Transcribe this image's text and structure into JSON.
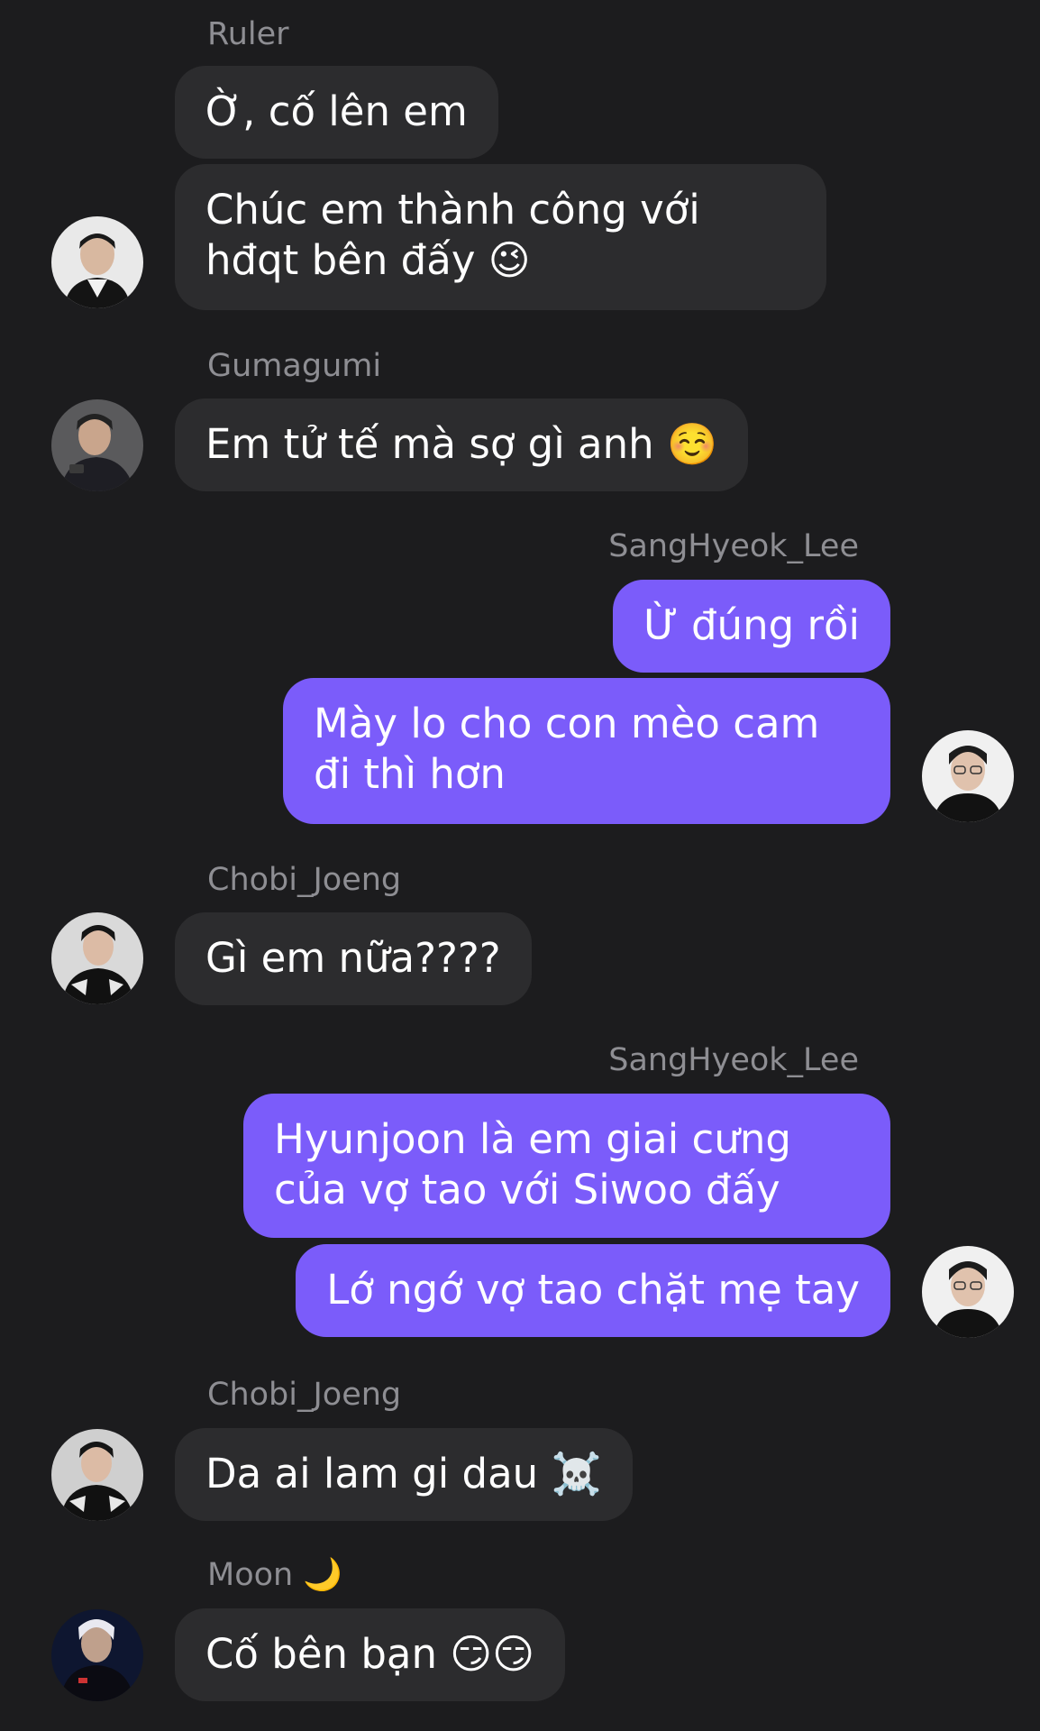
{
  "colors": {
    "background": "#1c1c1e",
    "incoming_bubble": "#2c2c2e",
    "outgoing_bubble": "#7b5cfa",
    "sender_name": "#8e8e93",
    "text": "#ffffff"
  },
  "messages": {
    "g1": {
      "sender": "Ruler",
      "m1": "Ờ, cố lên em",
      "m2": "Chúc em thành công với hđqt bên đấy 😉"
    },
    "g2": {
      "sender": "Gumagumi",
      "m1": "Em tử tế mà sợ gì anh ☺️"
    },
    "g3": {
      "sender": "SangHyeok_Lee",
      "m1": "Ừ đúng rồi",
      "m2": "Mày lo cho con mèo cam đi thì hơn"
    },
    "g4": {
      "sender": "Chobi_Joeng",
      "m1": "Gì em nữa????"
    },
    "g5": {
      "sender": "SangHyeok_Lee",
      "m1": "Hyunjoon là em giai cưng của vợ tao với Siwoo đấy",
      "m2": "Lớ ngớ vợ tao chặt mẹ tay"
    },
    "g6": {
      "sender": "Chobi_Joeng",
      "m1": "Da ai lam gi dau ☠️"
    },
    "g7": {
      "sender": "Moon 🌙",
      "m1": "Cố bên bạn 😏😏"
    }
  }
}
